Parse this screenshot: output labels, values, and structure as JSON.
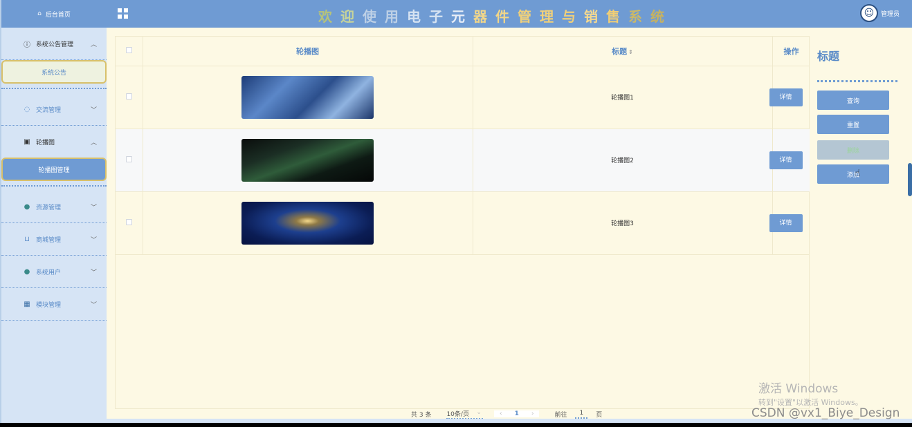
{
  "app": {
    "title_chars": [
      "欢",
      "迎",
      "使",
      "用",
      "电",
      "子",
      "元",
      "器",
      "件",
      "管",
      "理",
      "与",
      "销",
      "售",
      "系",
      "统"
    ],
    "title_colors": [
      "#b6c37a",
      "#c7d49a",
      "#bdd0e6",
      "#bdd0e6",
      "#d6e3f2",
      "#d6e3f2",
      "#e8eef7",
      "#f1d689",
      "#f1d689",
      "#f0d07a",
      "#f0d07a",
      "#efcf7a",
      "#f5d98f",
      "#f0ce76",
      "#c9b86a",
      "#c6b261"
    ]
  },
  "user": {
    "name": "管理员"
  },
  "sidebar": {
    "home_label": "后台首页",
    "groups": [
      {
        "label": "系统公告管理",
        "icon": "info-circle-icon",
        "expanded": true,
        "items": [
          {
            "label": "系统公告"
          }
        ]
      },
      {
        "label": "交流管理",
        "icon": "chat-bubble-icon",
        "expanded": false
      },
      {
        "label": "轮播图",
        "icon": "image-icon",
        "expanded": true,
        "items": [
          {
            "label": "轮播图管理",
            "active": true
          }
        ]
      },
      {
        "label": "资源管理",
        "icon": "location-pin-icon",
        "expanded": false
      },
      {
        "label": "商城管理",
        "icon": "cart-icon",
        "expanded": false
      },
      {
        "label": "系统用户",
        "icon": "user-icon",
        "expanded": false
      },
      {
        "label": "模块管理",
        "icon": "grid-icon",
        "expanded": false
      }
    ]
  },
  "table": {
    "headers": {
      "image": "轮播图",
      "title": "标题",
      "action": "操作"
    },
    "rows": [
      {
        "title": "轮播图1",
        "action": "详情"
      },
      {
        "title": "轮播图2",
        "action": "详情"
      },
      {
        "title": "轮播图3",
        "action": "详情"
      }
    ]
  },
  "right_panel": {
    "title": "标题",
    "buttons": {
      "search": "查询",
      "reset": "重置",
      "delete": "删除",
      "add": "添加"
    }
  },
  "pagination": {
    "total": "共 3 条",
    "page_size": "10条/页",
    "current_page": "1",
    "goto_prefix": "前往",
    "goto_value": "1",
    "goto_suffix": "页"
  },
  "watermark": {
    "win_line1": "激活 Windows",
    "win_line2": "转到\"设置\"以激活 Windows。",
    "csdn": "CSDN @vx1_Biye_Design"
  }
}
